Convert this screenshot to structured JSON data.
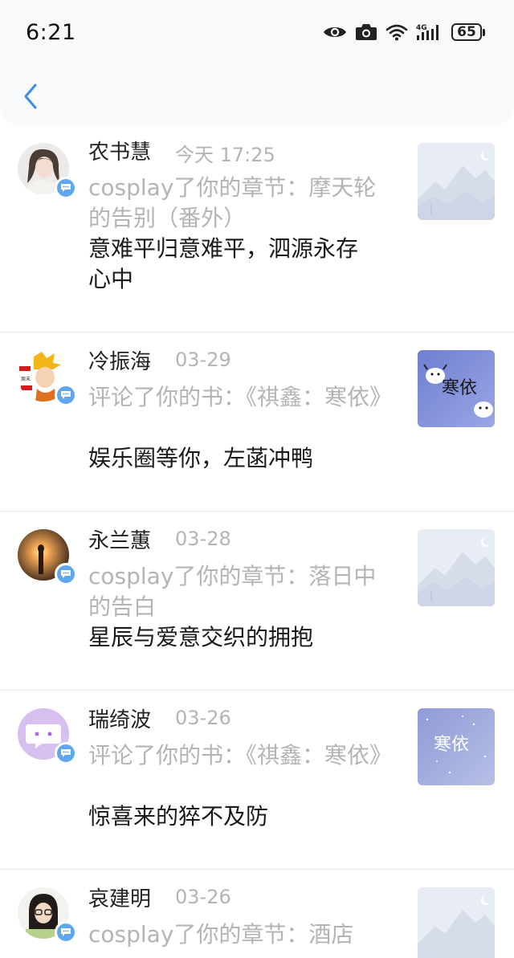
{
  "status_bar": {
    "time": "6:21",
    "network": "4G",
    "battery": "65"
  },
  "notifications": [
    {
      "name": "农书慧",
      "date": "今天 17:25",
      "action": "cosplay了你的章节：摩天轮的告别（番外）",
      "message": "意难平归意难平，泗源永存心中",
      "thumbnail": "placeholder-mountain"
    },
    {
      "name": "冷振海",
      "date": "03-29",
      "action": "评论了你的书：《祺鑫：寒依》",
      "message": "娱乐圈等你，左菡冲鸭",
      "thumbnail": "cover-hanyi-cartoon",
      "thumb_text": "寒依"
    },
    {
      "name": "永兰蕙",
      "date": "03-28",
      "action": "cosplay了你的章节：落日中的告白",
      "message": "星辰与爱意交织的拥抱",
      "thumbnail": "placeholder-mountain"
    },
    {
      "name": "瑞绮波",
      "date": "03-26",
      "action": "评论了你的书：《祺鑫：寒依》",
      "message": "惊喜来的猝不及防",
      "thumbnail": "cover-hanyi-snow",
      "thumb_text": "寒依"
    },
    {
      "name": "哀建明",
      "date": "03-26",
      "action": "cosplay了你的章节：酒店",
      "message": "",
      "thumbnail": "placeholder-mountain"
    }
  ]
}
